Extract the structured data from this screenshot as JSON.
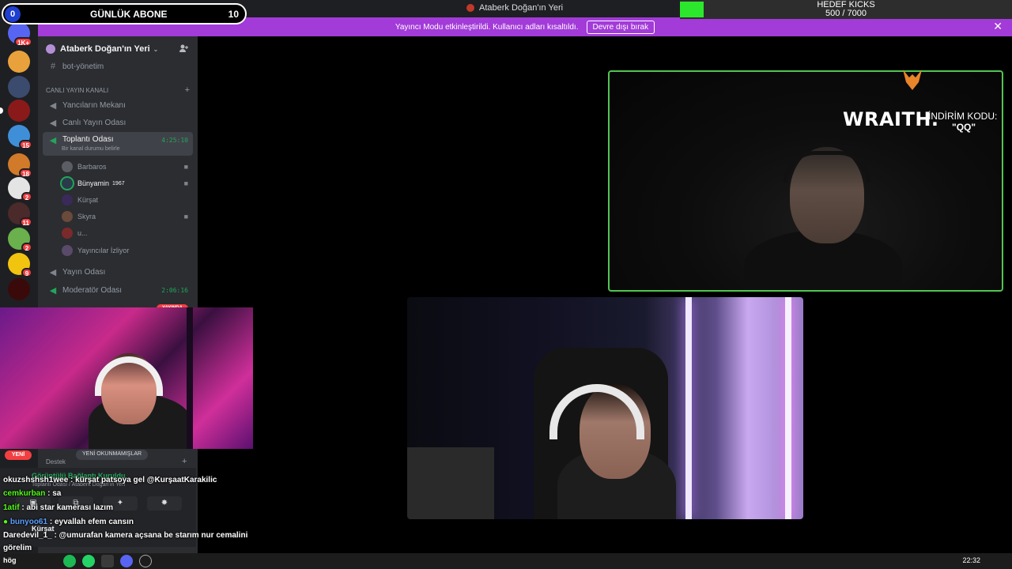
{
  "window": {
    "title": "Ataberk Doğan'ın Yeri"
  },
  "banner": {
    "message": "Yayıncı Modu etkinleştirildi. Kullanıcı adları kısaltıldı.",
    "disable_label": "Devre dışı bırak",
    "close_glyph": "✕"
  },
  "overlays": {
    "sub_goal": {
      "count": "0",
      "label": "GÜNLÜK ABONE",
      "target": "10"
    },
    "kick_goal": {
      "label": "HEDEF KICKS",
      "progress": "500 / 7000",
      "fraction": 0.0714
    }
  },
  "server_rail": {
    "badges": [
      "1K+",
      "15",
      "18",
      "2",
      "11",
      "2",
      "9"
    ]
  },
  "sidebar": {
    "server_name": "Ataberk Doğan'ın Yeri",
    "server_chevron": "⌄",
    "invite_icon": "person-add-icon",
    "channels": {
      "bot": "bot-yönetim",
      "category_live": "CANLI YAYIN KANALI",
      "yancilar": "Yancıların Mekanı",
      "canli": "Canlı Yayın Odası",
      "toplanti": "Toplantı Odası",
      "toplanti_timer": "4:25:10",
      "toplanti_status": "Bir kanal durumu belirle",
      "yayin": "Yayın Odası",
      "moderator": "Moderatör Odası",
      "moderator_timer": "2:06:16",
      "live_label": "YAYINDA"
    },
    "voice_users": [
      {
        "name": "Barbaros"
      },
      {
        "name": "Bünyamin",
        "tag": "1967"
      },
      {
        "name": "Kürşat"
      },
      {
        "name": "Skyra"
      },
      {
        "name": "u..."
      },
      {
        "name": "Yayıncılar İzliyor"
      }
    ],
    "new_badge": "YENİ",
    "destek": "Destek",
    "new_unread": "YENİ OKUNMAMIŞLAR",
    "voice_connected": "Görüntülü Bağlantı Kuruldu",
    "voice_path": "Toplantı Odası / Ataberk Doğan'ın Yeri",
    "user_name": "Kürşat"
  },
  "promo": {
    "brand": "WRAITH.",
    "label": "İNDİRİM KODU:",
    "code": "\"QQ\""
  },
  "chat": [
    {
      "user": "okuzshshsh1wee",
      "message": ": kürşat patsoya gel @KurşaatKarakilic",
      "color": "white"
    },
    {
      "user": "cemkurban",
      "message": ": sa",
      "color": "green"
    },
    {
      "user": "1atif",
      "message": ": abi star kamerası lazım",
      "color": "green"
    },
    {
      "user": "bunyoo61",
      "message": ": eyvallah efem cansın",
      "color": "blue"
    },
    {
      "user": "Daredevil_1_",
      "message": ": @umurafan kamera açsana be starım nur cemalini",
      "color": "white"
    },
    {
      "user": "",
      "message": "görelim",
      "color": "white"
    }
  ],
  "taskbar": {
    "weather": "hög",
    "clock": "22:32"
  }
}
